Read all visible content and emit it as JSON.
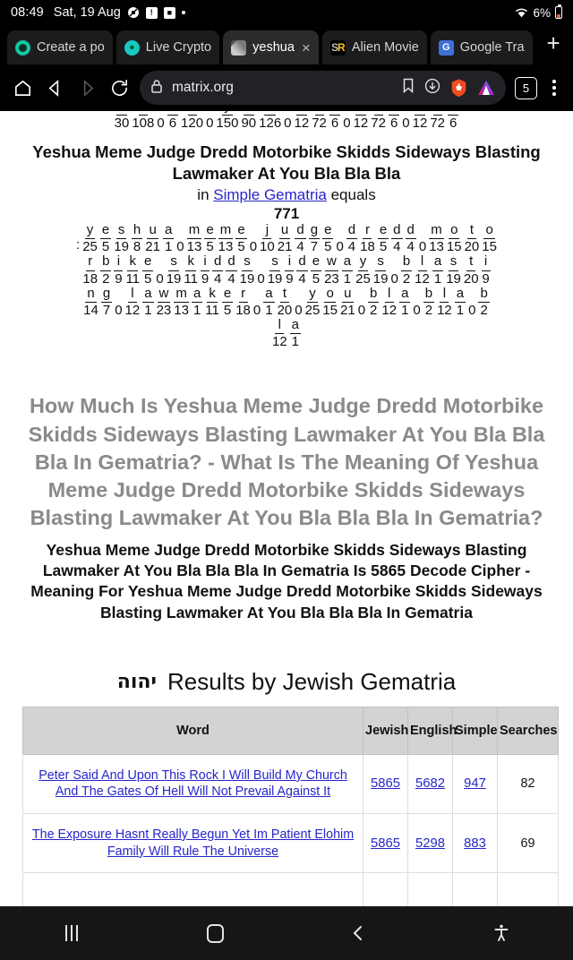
{
  "status_bar": {
    "time": "08:49",
    "date": "Sat, 19 Aug",
    "icons": [
      "no-sound-icon",
      "warning-battery-icon",
      "sim-icon",
      "dot-icon"
    ],
    "battery_percent": "6%",
    "wifi": "wifi-icon"
  },
  "tabs": [
    {
      "label": "Create a po",
      "favicon": "teal-circle-icon",
      "active": false
    },
    {
      "label": "Live Crypto",
      "favicon": "crypto-circle-icon",
      "active": false
    },
    {
      "label": "yeshua",
      "favicon": "image-thumb-icon",
      "active": true,
      "close": "×"
    },
    {
      "label": "Alien Movie",
      "favicon": "sr-icon",
      "active": false
    },
    {
      "label": "Google Tra",
      "favicon": "google-translate-icon",
      "active": false
    }
  ],
  "new_tab_label": "+",
  "toolbar": {
    "home": "home-icon",
    "back": "back-icon",
    "forward": "forward-icon",
    "reload": "reload-icon",
    "lock": "lock-icon",
    "url": "matrix.org",
    "bookmark": "bookmark-icon",
    "download": "download-icon",
    "brave": "brave-lion-icon",
    "shields": "triangle-icon",
    "tab_count": "5",
    "menu": "kebab-menu-icon"
  },
  "content": {
    "clipped_row": {
      "numerators": [
        "e",
        "r",
        "",
        "a",
        "t",
        "",
        "y",
        "o",
        "a",
        "",
        "b",
        "r",
        "a",
        "",
        "b",
        "r",
        "a",
        "",
        "b",
        "r",
        "a"
      ],
      "denominators": [
        "30",
        "108",
        "0",
        "6",
        "120",
        "0",
        "150",
        "90",
        "126",
        "0",
        "12",
        "72",
        "6",
        "0",
        "12",
        "72",
        "6",
        "0",
        "12",
        "72",
        "6"
      ]
    },
    "title_main": "Yeshua Meme Judge Dredd Motorbike Skidds Sideways Blasting Lawmaker At You Bla Bla Bla",
    "title_sub_prefix": "in ",
    "title_sub_link": "Simple Gematria",
    "title_sub_suffix": " equals",
    "title_value": "771",
    "breakdown_rows": [
      {
        "lead": ":",
        "cells": [
          {
            "n": "y",
            "d": "25"
          },
          {
            "n": "e",
            "d": "5"
          },
          {
            "n": "s",
            "d": "19"
          },
          {
            "n": "h",
            "d": "8"
          },
          {
            "n": "u",
            "d": "21"
          },
          {
            "n": "a",
            "d": "1"
          },
          {
            "sep": "0"
          },
          {
            "n": "m",
            "d": "13"
          },
          {
            "n": "e",
            "d": "5"
          },
          {
            "n": "m",
            "d": "13"
          },
          {
            "n": "e",
            "d": "5"
          },
          {
            "sep": "0"
          },
          {
            "n": "j",
            "d": "10"
          },
          {
            "n": "u",
            "d": "21"
          },
          {
            "n": "d",
            "d": "4"
          },
          {
            "n": "g",
            "d": "7"
          },
          {
            "n": "e",
            "d": "5"
          },
          {
            "sep": "0"
          },
          {
            "n": "d",
            "d": "4"
          },
          {
            "n": "r",
            "d": "18"
          },
          {
            "n": "e",
            "d": "5"
          },
          {
            "n": "d",
            "d": "4"
          },
          {
            "n": "d",
            "d": "4"
          },
          {
            "sep": "0"
          },
          {
            "n": "m",
            "d": "13"
          },
          {
            "n": "o",
            "d": "15"
          },
          {
            "n": "t",
            "d": "20"
          },
          {
            "n": "o",
            "d": "15"
          }
        ]
      },
      {
        "lead": "",
        "cells": [
          {
            "n": "r",
            "d": "18"
          },
          {
            "n": "b",
            "d": "2"
          },
          {
            "n": "i",
            "d": "9"
          },
          {
            "n": "k",
            "d": "11"
          },
          {
            "n": "e",
            "d": "5"
          },
          {
            "sep": "0"
          },
          {
            "n": "s",
            "d": "19"
          },
          {
            "n": "k",
            "d": "11"
          },
          {
            "n": "i",
            "d": "9"
          },
          {
            "n": "d",
            "d": "4"
          },
          {
            "n": "d",
            "d": "4"
          },
          {
            "n": "s",
            "d": "19"
          },
          {
            "sep": "0"
          },
          {
            "n": "s",
            "d": "19"
          },
          {
            "n": "i",
            "d": "9"
          },
          {
            "n": "d",
            "d": "4"
          },
          {
            "n": "e",
            "d": "5"
          },
          {
            "n": "w",
            "d": "23"
          },
          {
            "n": "a",
            "d": "1"
          },
          {
            "n": "y",
            "d": "25"
          },
          {
            "n": "s",
            "d": "19"
          },
          {
            "sep": "0"
          },
          {
            "n": "b",
            "d": "2"
          },
          {
            "n": "l",
            "d": "12"
          },
          {
            "n": "a",
            "d": "1"
          },
          {
            "n": "s",
            "d": "19"
          },
          {
            "n": "t",
            "d": "20"
          },
          {
            "n": "i",
            "d": "9"
          }
        ]
      },
      {
        "lead": "",
        "cells": [
          {
            "n": "n",
            "d": "14"
          },
          {
            "n": "g",
            "d": "7"
          },
          {
            "sep": "0"
          },
          {
            "n": "l",
            "d": "12"
          },
          {
            "n": "a",
            "d": "1"
          },
          {
            "n": "w",
            "d": "23"
          },
          {
            "n": "m",
            "d": "13"
          },
          {
            "n": "a",
            "d": "1"
          },
          {
            "n": "k",
            "d": "11"
          },
          {
            "n": "e",
            "d": "5"
          },
          {
            "n": "r",
            "d": "18"
          },
          {
            "sep": "0"
          },
          {
            "n": "a",
            "d": "1"
          },
          {
            "n": "t",
            "d": "20"
          },
          {
            "sep": "0"
          },
          {
            "n": "y",
            "d": "25"
          },
          {
            "n": "o",
            "d": "15"
          },
          {
            "n": "u",
            "d": "21"
          },
          {
            "sep": "0"
          },
          {
            "n": "b",
            "d": "2"
          },
          {
            "n": "l",
            "d": "12"
          },
          {
            "n": "a",
            "d": "1"
          },
          {
            "sep": "0"
          },
          {
            "n": "b",
            "d": "2"
          },
          {
            "n": "l",
            "d": "12"
          },
          {
            "n": "a",
            "d": "1"
          },
          {
            "sep": "0"
          },
          {
            "n": "b",
            "d": "2"
          }
        ]
      },
      {
        "lead": "",
        "cells": [
          {
            "n": "l",
            "d": "12"
          },
          {
            "n": "a",
            "d": "1"
          }
        ]
      }
    ],
    "gray_headline": "How Much Is Yeshua Meme Judge Dredd Motorbike Skidds Sideways Blasting Lawmaker At You Bla Bla Bla In Gematria? - What Is The Meaning Of Yeshua Meme Judge Dredd Motorbike Skidds Sideways Blasting Lawmaker At You Bla Bla Bla In Gematria?",
    "black_headline": "Yeshua Meme Judge Dredd Motorbike Skidds Sideways Blasting Lawmaker At You Bla Bla Bla In Gematria Is 5865 Decode Cipher - Meaning For Yeshua Meme Judge Dredd Motorbike Skidds Sideways Blasting Lawmaker At You Bla Bla Bla In Gematria",
    "results_hebrew": "יהוה",
    "results_title": "Results by Jewish Gematria",
    "table": {
      "headers": [
        "Word",
        "Jewish",
        "English",
        "Simple",
        "Searches"
      ],
      "rows": [
        {
          "word": "Peter Said And Upon This Rock I Will Build My Church And The Gates Of Hell Will Not Prevail Against It",
          "jewish": "5865",
          "english": "5682",
          "simple": "947",
          "searches": "82"
        },
        {
          "word": "The Exposure Hasnt Really Begun Yet Im Patient Elohim Family Will Rule The Universe",
          "jewish": "5865",
          "english": "5298",
          "simple": "883",
          "searches": "69"
        }
      ]
    }
  },
  "nav_bar": {
    "recents": "recents-icon",
    "home": "home-icon",
    "back": "back-icon",
    "accessibility": "accessibility-icon"
  }
}
